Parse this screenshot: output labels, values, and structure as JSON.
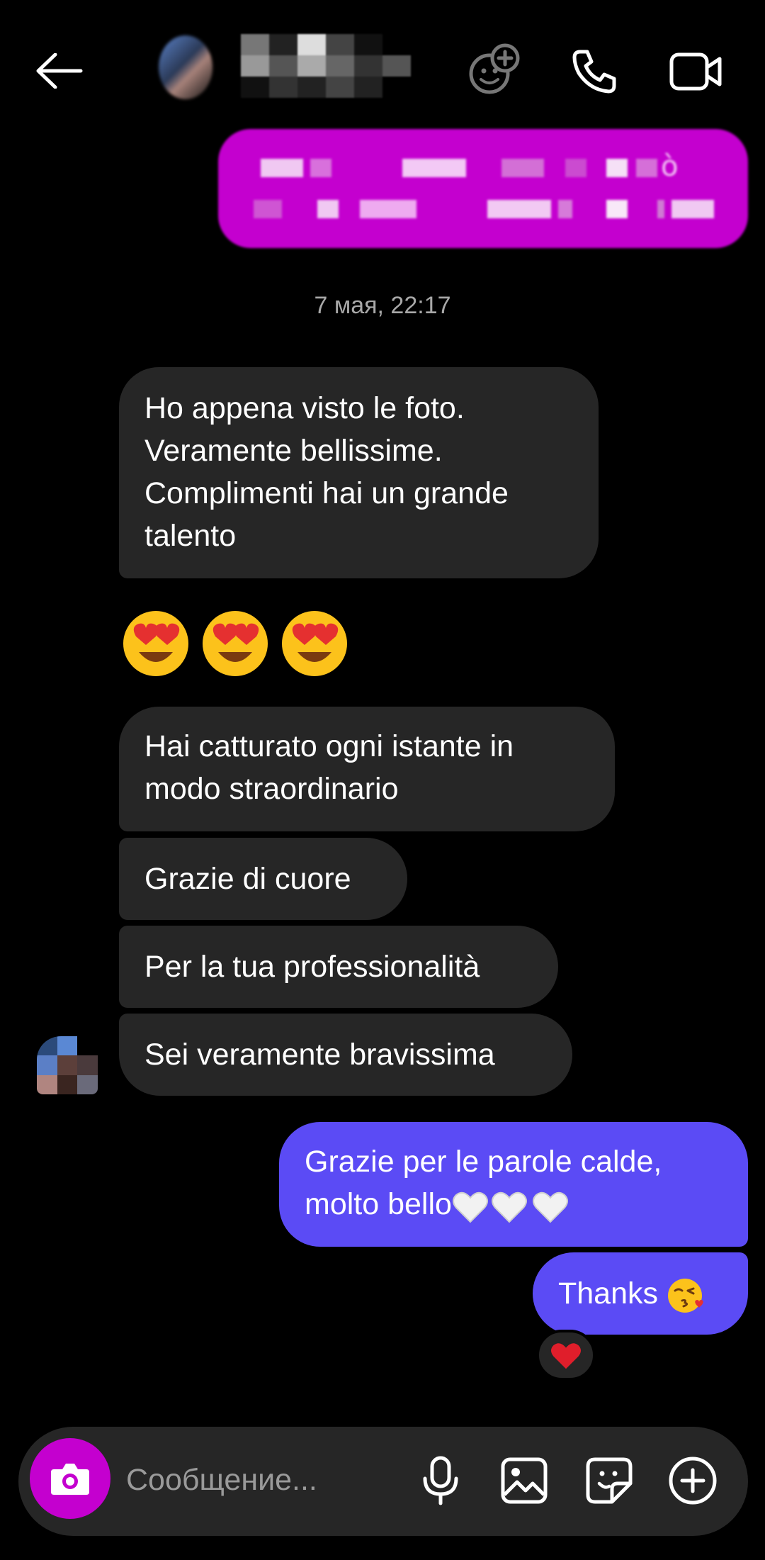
{
  "header": {
    "back_icon": "arrow-left-icon",
    "contact_name": "",
    "add_people_icon": "add-people-icon",
    "call_icon": "phone-icon",
    "video_icon": "video-camera-icon"
  },
  "conversation": {
    "sent_redacted_char": "ò",
    "timestamp": "7 мая, 22:17",
    "received": [
      "Ho appena visto le foto. Veramente bellissime. Complimenti hai un grande talento",
      "Hai catturato ogni istante in modo straordinario",
      "Grazie di cuore",
      "Per la tua professionalità",
      "Sei veramente bravissima"
    ],
    "received_emoji": [
      "heart-eyes-emoji",
      "heart-eyes-emoji",
      "heart-eyes-emoji"
    ],
    "sent": [
      {
        "text": "Grazie per le parole calde, molto bello",
        "emoji": [
          "white-heart-emoji",
          "white-heart-emoji",
          "white-heart-emoji"
        ]
      },
      {
        "text": "Thanks",
        "emoji": [
          "kissing-face-emoji"
        ]
      }
    ],
    "reaction": "red-heart-emoji"
  },
  "composer": {
    "placeholder": "Сообщение...",
    "camera_icon": "camera-icon",
    "mic_icon": "microphone-icon",
    "gallery_icon": "image-icon",
    "sticker_icon": "sticker-icon",
    "plus_icon": "plus-circle-icon"
  },
  "colors": {
    "background": "#000000",
    "received_bubble": "#262626",
    "sent_bubble": "#5b4bf5",
    "accent_magenta": "#c400cf",
    "timestamp_text": "#a8a8a8"
  }
}
